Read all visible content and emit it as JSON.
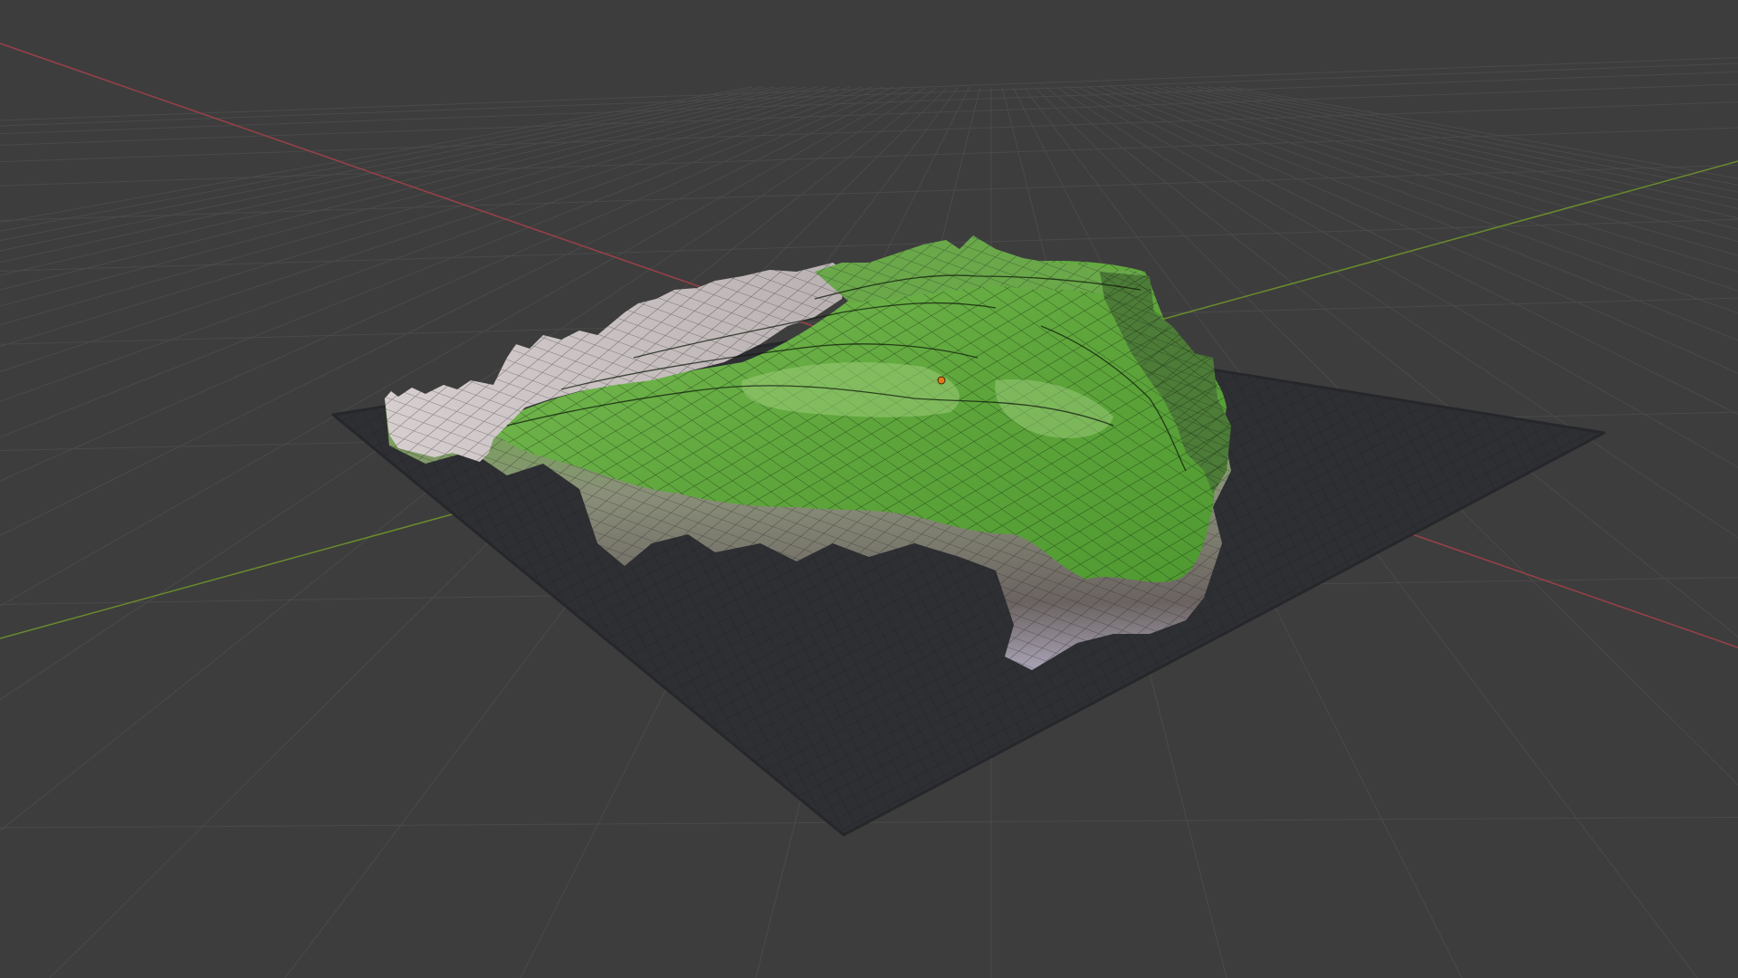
{
  "app": {
    "kind": "3d-viewport",
    "view": "perspective"
  },
  "scene": {
    "objects": [
      {
        "name": "terrain-mesh",
        "type": "mesh",
        "display": "solid-with-wireframe",
        "selected": true
      },
      {
        "name": "ground-plane",
        "type": "mesh",
        "display": "solid-with-wireframe",
        "selected": false
      }
    ],
    "origin_marker": "origin-dot"
  },
  "colors": {
    "background": "#3d3d3d",
    "grid_line": "#4a4a4a",
    "x_axis": "#9b4048",
    "y_axis": "#6a8b2d",
    "plane_fill": "#2f3034",
    "plane_wire": "#23252a",
    "terrain_grass": "#5ea23b",
    "terrain_grass_light": "#8fc46a",
    "terrain_rock": "#cfc6c6",
    "terrain_cliff": "#5f5a58",
    "terrain_wire": "#111111",
    "origin": "#e07b1a"
  }
}
